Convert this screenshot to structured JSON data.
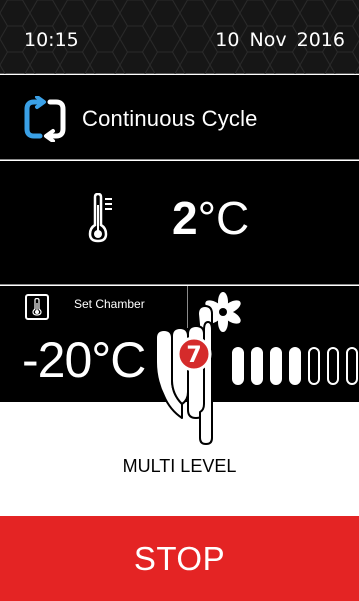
{
  "status": {
    "time": "10:15",
    "date": "10 Nov 2016"
  },
  "cycle": {
    "label": "Continuous Cycle",
    "icon": "continuous-cycle-icon"
  },
  "temperature": {
    "value": "2",
    "unit": "°C",
    "icon": "thermometer-icon"
  },
  "set_chamber": {
    "label": "Set Chamber",
    "setpoint": "-20°C",
    "icon": "chamber-thermometer-icon"
  },
  "fan": {
    "icon": "fan-icon",
    "levels_total": 7,
    "levels_on": 4
  },
  "callout": {
    "number": "7",
    "color": "#d52b2b"
  },
  "mode": {
    "label": "MULTI LEVEL"
  },
  "stop": {
    "label": "STOP",
    "color": "#e42424"
  }
}
